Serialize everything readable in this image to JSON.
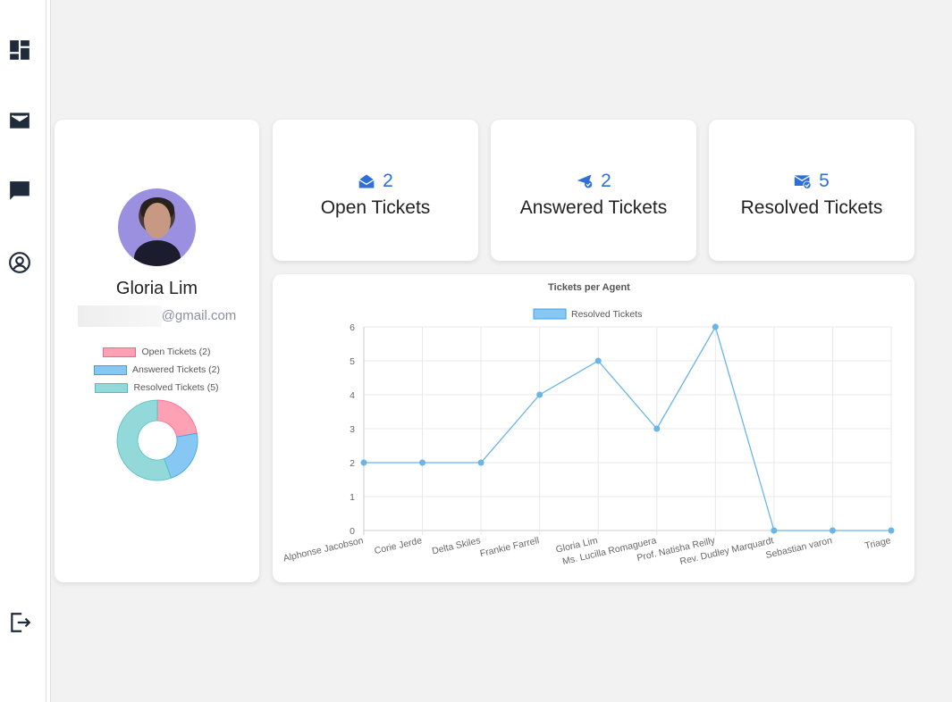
{
  "sidebar": {
    "items": [
      {
        "icon": "dashboard-icon"
      },
      {
        "icon": "mail-icon"
      },
      {
        "icon": "chat-icon"
      },
      {
        "icon": "account-circle-icon"
      }
    ],
    "logout_icon": "logout-icon"
  },
  "profile": {
    "name": "Gloria Lim",
    "email_domain": "@gmail.com",
    "legend": [
      {
        "label": "Open Tickets (2)",
        "fill": "#ffa1b5",
        "stroke": "#ff6384"
      },
      {
        "label": "Answered Tickets (2)",
        "fill": "#86c7f3",
        "stroke": "#36a2eb"
      },
      {
        "label": "Resolved Tickets (5)",
        "fill": "#93d9d9",
        "stroke": "#4bc0c0"
      }
    ],
    "donut_values": [
      2,
      2,
      5
    ]
  },
  "stats": [
    {
      "count": "2",
      "label": "Open Tickets",
      "icon": "open-envelope-icon"
    },
    {
      "count": "2",
      "label": "Answered Tickets",
      "icon": "paper-plane-check-icon"
    },
    {
      "count": "5",
      "label": "Resolved Tickets",
      "icon": "envelope-check-icon"
    }
  ],
  "colors": {
    "accent": "#2d6fd6",
    "line": "#6ab4e6"
  },
  "chart_data": {
    "type": "line",
    "title": "Tickets per Agent",
    "categories": [
      "Alphonse Jacobson",
      "Corie Jerde",
      "Delta Skiles",
      "Frankie Farrell",
      "Gloria Lim",
      "Ms. Lucilla Romaguera",
      "Prof. Natisha Reilly",
      "Rev. Dudley Marquardt",
      "Sebastian varon",
      "Triage"
    ],
    "series": [
      {
        "name": "Resolved Tickets",
        "values": [
          2,
          2,
          2,
          4,
          5,
          3,
          6,
          0,
          0,
          0
        ]
      }
    ],
    "ylim": [
      0,
      6
    ],
    "yticks": [
      "0",
      "1",
      "2",
      "3",
      "4",
      "5",
      "6"
    ],
    "grid": true,
    "legend": "top"
  }
}
